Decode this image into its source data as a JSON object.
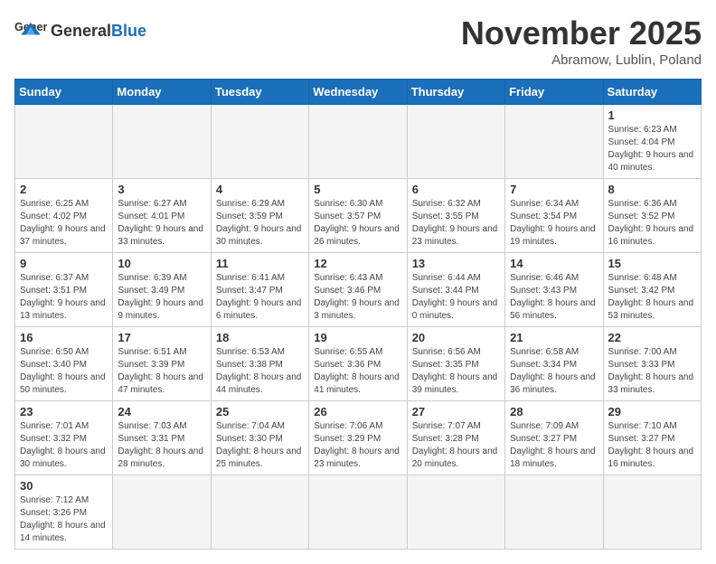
{
  "header": {
    "logo_general": "General",
    "logo_blue": "Blue",
    "month_title": "November 2025",
    "location": "Abramow, Lublin, Poland"
  },
  "days_of_week": [
    "Sunday",
    "Monday",
    "Tuesday",
    "Wednesday",
    "Thursday",
    "Friday",
    "Saturday"
  ],
  "weeks": [
    [
      {
        "day": "",
        "info": ""
      },
      {
        "day": "",
        "info": ""
      },
      {
        "day": "",
        "info": ""
      },
      {
        "day": "",
        "info": ""
      },
      {
        "day": "",
        "info": ""
      },
      {
        "day": "",
        "info": ""
      },
      {
        "day": "1",
        "info": "Sunrise: 6:23 AM\nSunset: 4:04 PM\nDaylight: 9 hours and 40 minutes."
      }
    ],
    [
      {
        "day": "2",
        "info": "Sunrise: 6:25 AM\nSunset: 4:02 PM\nDaylight: 9 hours and 37 minutes."
      },
      {
        "day": "3",
        "info": "Sunrise: 6:27 AM\nSunset: 4:01 PM\nDaylight: 9 hours and 33 minutes."
      },
      {
        "day": "4",
        "info": "Sunrise: 6:29 AM\nSunset: 3:59 PM\nDaylight: 9 hours and 30 minutes."
      },
      {
        "day": "5",
        "info": "Sunrise: 6:30 AM\nSunset: 3:57 PM\nDaylight: 9 hours and 26 minutes."
      },
      {
        "day": "6",
        "info": "Sunrise: 6:32 AM\nSunset: 3:55 PM\nDaylight: 9 hours and 23 minutes."
      },
      {
        "day": "7",
        "info": "Sunrise: 6:34 AM\nSunset: 3:54 PM\nDaylight: 9 hours and 19 minutes."
      },
      {
        "day": "8",
        "info": "Sunrise: 6:36 AM\nSunset: 3:52 PM\nDaylight: 9 hours and 16 minutes."
      }
    ],
    [
      {
        "day": "9",
        "info": "Sunrise: 6:37 AM\nSunset: 3:51 PM\nDaylight: 9 hours and 13 minutes."
      },
      {
        "day": "10",
        "info": "Sunrise: 6:39 AM\nSunset: 3:49 PM\nDaylight: 9 hours and 9 minutes."
      },
      {
        "day": "11",
        "info": "Sunrise: 6:41 AM\nSunset: 3:47 PM\nDaylight: 9 hours and 6 minutes."
      },
      {
        "day": "12",
        "info": "Sunrise: 6:43 AM\nSunset: 3:46 PM\nDaylight: 9 hours and 3 minutes."
      },
      {
        "day": "13",
        "info": "Sunrise: 6:44 AM\nSunset: 3:44 PM\nDaylight: 9 hours and 0 minutes."
      },
      {
        "day": "14",
        "info": "Sunrise: 6:46 AM\nSunset: 3:43 PM\nDaylight: 8 hours and 56 minutes."
      },
      {
        "day": "15",
        "info": "Sunrise: 6:48 AM\nSunset: 3:42 PM\nDaylight: 8 hours and 53 minutes."
      }
    ],
    [
      {
        "day": "16",
        "info": "Sunrise: 6:50 AM\nSunset: 3:40 PM\nDaylight: 8 hours and 50 minutes."
      },
      {
        "day": "17",
        "info": "Sunrise: 6:51 AM\nSunset: 3:39 PM\nDaylight: 8 hours and 47 minutes."
      },
      {
        "day": "18",
        "info": "Sunrise: 6:53 AM\nSunset: 3:38 PM\nDaylight: 8 hours and 44 minutes."
      },
      {
        "day": "19",
        "info": "Sunrise: 6:55 AM\nSunset: 3:36 PM\nDaylight: 8 hours and 41 minutes."
      },
      {
        "day": "20",
        "info": "Sunrise: 6:56 AM\nSunset: 3:35 PM\nDaylight: 8 hours and 39 minutes."
      },
      {
        "day": "21",
        "info": "Sunrise: 6:58 AM\nSunset: 3:34 PM\nDaylight: 8 hours and 36 minutes."
      },
      {
        "day": "22",
        "info": "Sunrise: 7:00 AM\nSunset: 3:33 PM\nDaylight: 8 hours and 33 minutes."
      }
    ],
    [
      {
        "day": "23",
        "info": "Sunrise: 7:01 AM\nSunset: 3:32 PM\nDaylight: 8 hours and 30 minutes."
      },
      {
        "day": "24",
        "info": "Sunrise: 7:03 AM\nSunset: 3:31 PM\nDaylight: 8 hours and 28 minutes."
      },
      {
        "day": "25",
        "info": "Sunrise: 7:04 AM\nSunset: 3:30 PM\nDaylight: 8 hours and 25 minutes."
      },
      {
        "day": "26",
        "info": "Sunrise: 7:06 AM\nSunset: 3:29 PM\nDaylight: 8 hours and 23 minutes."
      },
      {
        "day": "27",
        "info": "Sunrise: 7:07 AM\nSunset: 3:28 PM\nDaylight: 8 hours and 20 minutes."
      },
      {
        "day": "28",
        "info": "Sunrise: 7:09 AM\nSunset: 3:27 PM\nDaylight: 8 hours and 18 minutes."
      },
      {
        "day": "29",
        "info": "Sunrise: 7:10 AM\nSunset: 3:27 PM\nDaylight: 8 hours and 16 minutes."
      }
    ],
    [
      {
        "day": "30",
        "info": "Sunrise: 7:12 AM\nSunset: 3:26 PM\nDaylight: 8 hours and 14 minutes."
      },
      {
        "day": "",
        "info": ""
      },
      {
        "day": "",
        "info": ""
      },
      {
        "day": "",
        "info": ""
      },
      {
        "day": "",
        "info": ""
      },
      {
        "day": "",
        "info": ""
      },
      {
        "day": "",
        "info": ""
      }
    ]
  ]
}
